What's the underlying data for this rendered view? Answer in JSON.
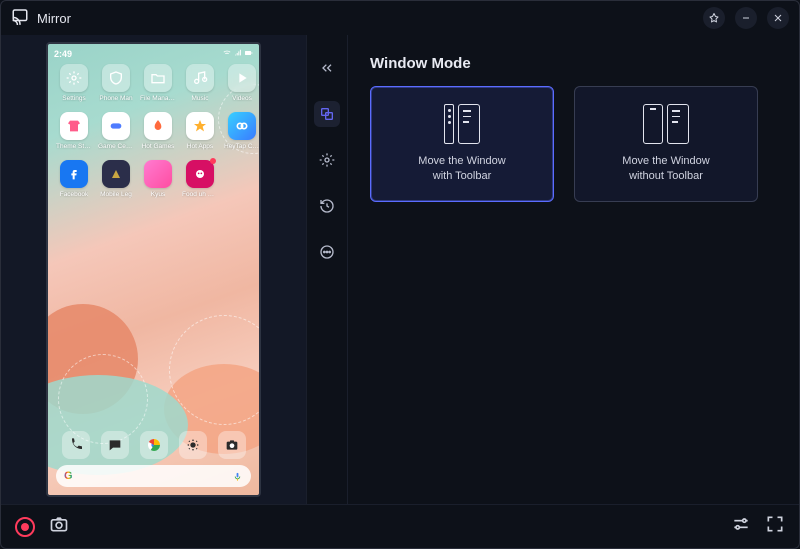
{
  "app": {
    "title": "Mirror"
  },
  "window_controls": {
    "pin": "pin",
    "minimize": "minimize",
    "close": "close"
  },
  "phone": {
    "clock": "2:49",
    "status_icons": [
      "n1",
      "n2",
      "n3",
      "n4"
    ],
    "right_icons": [
      "vo",
      "wifi",
      "signal",
      "battery"
    ],
    "apps_row1": [
      {
        "label": "Settings",
        "icon": "gear"
      },
      {
        "label": "Phone Man",
        "icon": "shield"
      },
      {
        "label": "File Manager",
        "icon": "folder"
      },
      {
        "label": "Music",
        "icon": "music"
      },
      {
        "label": "Videos",
        "icon": "play"
      }
    ],
    "apps_row2": [
      {
        "label": "Theme Store",
        "icon": "tshirt"
      },
      {
        "label": "Game Center",
        "icon": "gamepad"
      },
      {
        "label": "Hot Games",
        "icon": "flame"
      },
      {
        "label": "Hot Apps",
        "icon": "star"
      },
      {
        "label": "HeyTap Cloud",
        "icon": "infinity"
      }
    ],
    "apps_row3": [
      {
        "label": "Facebook",
        "icon": "fb"
      },
      {
        "label": "Mobile Leg",
        "icon": "ml"
      },
      {
        "label": "Kyus",
        "icon": "pink"
      },
      {
        "label": "Food uh M...",
        "icon": "fp",
        "badge": true
      },
      {
        "label": "",
        "icon": ""
      }
    ],
    "dock": [
      {
        "icon": "phone"
      },
      {
        "icon": "message"
      },
      {
        "icon": "chrome"
      },
      {
        "icon": "gallery"
      },
      {
        "icon": "camera"
      }
    ],
    "search_brand": "G",
    "search_placeholder": ""
  },
  "side_tools": {
    "items": [
      {
        "name": "collapse",
        "active": false
      },
      {
        "name": "window-mode",
        "active": true
      },
      {
        "name": "settings-cog",
        "active": false
      },
      {
        "name": "history",
        "active": false
      },
      {
        "name": "more",
        "active": false
      }
    ]
  },
  "window_mode": {
    "title": "Window Mode",
    "cards": [
      {
        "label_line1": "Move the Window",
        "label_line2": "with Toolbar",
        "selected": true
      },
      {
        "label_line1": "Move the Window",
        "label_line2": "without Toolbar",
        "selected": false
      }
    ]
  },
  "bottom": {
    "record": "record",
    "screenshot": "screenshot",
    "settings_list": "settings",
    "fullscreen": "fullscreen"
  }
}
